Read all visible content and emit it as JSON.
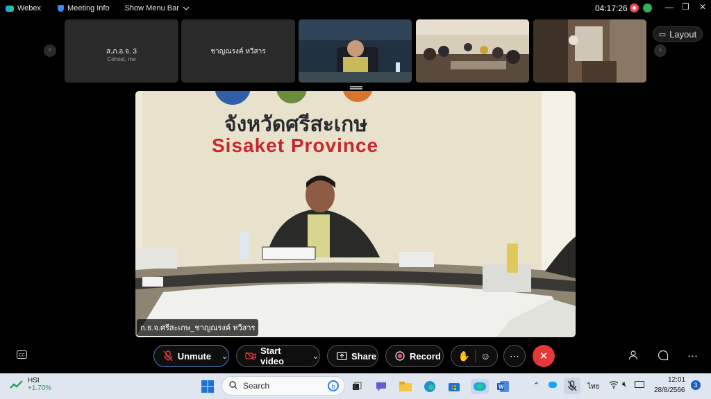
{
  "titlebar": {
    "app_name": "Webex",
    "meeting_info": "Meeting Info",
    "show_menu_bar": "Show Menu Bar",
    "clock": "04:17:26"
  },
  "participants": [
    {
      "name": "ส.ภ.อ.จ. 3",
      "sub": "Cohost, me"
    },
    {
      "name": "ชาญณรงค์ หวีสาร",
      "sub": ""
    }
  ],
  "layout_label": "Layout",
  "main_video": {
    "caption": "ก.ธ.จ.ศรีสะเกษ_ชาญณรงค์ หวีสาร",
    "sign_thai": "จังหวัดศรีสะเกษ",
    "sign_english": "Sisaket Province"
  },
  "controls": {
    "unmute": "Unmute",
    "start_video": "Start video",
    "share": "Share",
    "record": "Record"
  },
  "taskbar": {
    "ticker_name": "HSI",
    "ticker_change": "+1.70%",
    "search_placeholder": "Search",
    "lang": "ไทย",
    "time": "12:01",
    "date": "28/8/2566",
    "notifications": "3"
  },
  "colors": {
    "end_call": "#e5383b",
    "record_dot": "#e74c5c",
    "ticker_green": "#1e9e4f"
  }
}
